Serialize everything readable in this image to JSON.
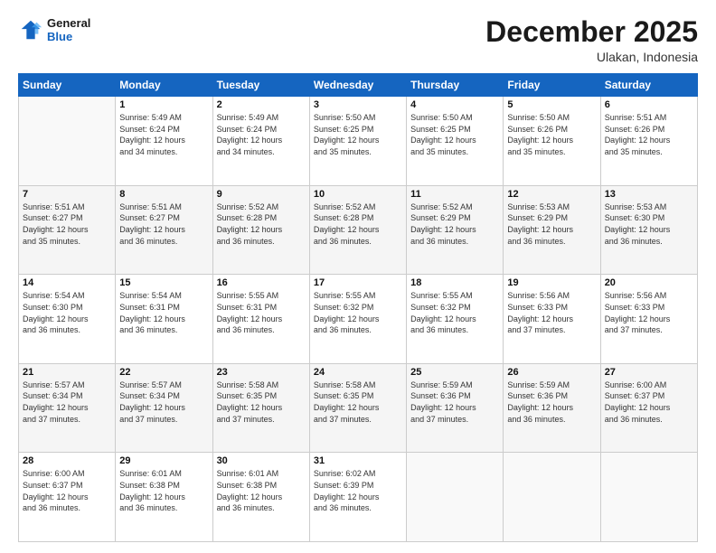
{
  "header": {
    "logo_line1": "General",
    "logo_line2": "Blue",
    "month": "December 2025",
    "location": "Ulakan, Indonesia"
  },
  "days_of_week": [
    "Sunday",
    "Monday",
    "Tuesday",
    "Wednesday",
    "Thursday",
    "Friday",
    "Saturday"
  ],
  "weeks": [
    [
      {
        "num": "",
        "info": ""
      },
      {
        "num": "1",
        "info": "Sunrise: 5:49 AM\nSunset: 6:24 PM\nDaylight: 12 hours\nand 34 minutes."
      },
      {
        "num": "2",
        "info": "Sunrise: 5:49 AM\nSunset: 6:24 PM\nDaylight: 12 hours\nand 34 minutes."
      },
      {
        "num": "3",
        "info": "Sunrise: 5:50 AM\nSunset: 6:25 PM\nDaylight: 12 hours\nand 35 minutes."
      },
      {
        "num": "4",
        "info": "Sunrise: 5:50 AM\nSunset: 6:25 PM\nDaylight: 12 hours\nand 35 minutes."
      },
      {
        "num": "5",
        "info": "Sunrise: 5:50 AM\nSunset: 6:26 PM\nDaylight: 12 hours\nand 35 minutes."
      },
      {
        "num": "6",
        "info": "Sunrise: 5:51 AM\nSunset: 6:26 PM\nDaylight: 12 hours\nand 35 minutes."
      }
    ],
    [
      {
        "num": "7",
        "info": "Sunrise: 5:51 AM\nSunset: 6:27 PM\nDaylight: 12 hours\nand 35 minutes."
      },
      {
        "num": "8",
        "info": "Sunrise: 5:51 AM\nSunset: 6:27 PM\nDaylight: 12 hours\nand 36 minutes."
      },
      {
        "num": "9",
        "info": "Sunrise: 5:52 AM\nSunset: 6:28 PM\nDaylight: 12 hours\nand 36 minutes."
      },
      {
        "num": "10",
        "info": "Sunrise: 5:52 AM\nSunset: 6:28 PM\nDaylight: 12 hours\nand 36 minutes."
      },
      {
        "num": "11",
        "info": "Sunrise: 5:52 AM\nSunset: 6:29 PM\nDaylight: 12 hours\nand 36 minutes."
      },
      {
        "num": "12",
        "info": "Sunrise: 5:53 AM\nSunset: 6:29 PM\nDaylight: 12 hours\nand 36 minutes."
      },
      {
        "num": "13",
        "info": "Sunrise: 5:53 AM\nSunset: 6:30 PM\nDaylight: 12 hours\nand 36 minutes."
      }
    ],
    [
      {
        "num": "14",
        "info": "Sunrise: 5:54 AM\nSunset: 6:30 PM\nDaylight: 12 hours\nand 36 minutes."
      },
      {
        "num": "15",
        "info": "Sunrise: 5:54 AM\nSunset: 6:31 PM\nDaylight: 12 hours\nand 36 minutes."
      },
      {
        "num": "16",
        "info": "Sunrise: 5:55 AM\nSunset: 6:31 PM\nDaylight: 12 hours\nand 36 minutes."
      },
      {
        "num": "17",
        "info": "Sunrise: 5:55 AM\nSunset: 6:32 PM\nDaylight: 12 hours\nand 36 minutes."
      },
      {
        "num": "18",
        "info": "Sunrise: 5:55 AM\nSunset: 6:32 PM\nDaylight: 12 hours\nand 36 minutes."
      },
      {
        "num": "19",
        "info": "Sunrise: 5:56 AM\nSunset: 6:33 PM\nDaylight: 12 hours\nand 37 minutes."
      },
      {
        "num": "20",
        "info": "Sunrise: 5:56 AM\nSunset: 6:33 PM\nDaylight: 12 hours\nand 37 minutes."
      }
    ],
    [
      {
        "num": "21",
        "info": "Sunrise: 5:57 AM\nSunset: 6:34 PM\nDaylight: 12 hours\nand 37 minutes."
      },
      {
        "num": "22",
        "info": "Sunrise: 5:57 AM\nSunset: 6:34 PM\nDaylight: 12 hours\nand 37 minutes."
      },
      {
        "num": "23",
        "info": "Sunrise: 5:58 AM\nSunset: 6:35 PM\nDaylight: 12 hours\nand 37 minutes."
      },
      {
        "num": "24",
        "info": "Sunrise: 5:58 AM\nSunset: 6:35 PM\nDaylight: 12 hours\nand 37 minutes."
      },
      {
        "num": "25",
        "info": "Sunrise: 5:59 AM\nSunset: 6:36 PM\nDaylight: 12 hours\nand 37 minutes."
      },
      {
        "num": "26",
        "info": "Sunrise: 5:59 AM\nSunset: 6:36 PM\nDaylight: 12 hours\nand 36 minutes."
      },
      {
        "num": "27",
        "info": "Sunrise: 6:00 AM\nSunset: 6:37 PM\nDaylight: 12 hours\nand 36 minutes."
      }
    ],
    [
      {
        "num": "28",
        "info": "Sunrise: 6:00 AM\nSunset: 6:37 PM\nDaylight: 12 hours\nand 36 minutes."
      },
      {
        "num": "29",
        "info": "Sunrise: 6:01 AM\nSunset: 6:38 PM\nDaylight: 12 hours\nand 36 minutes."
      },
      {
        "num": "30",
        "info": "Sunrise: 6:01 AM\nSunset: 6:38 PM\nDaylight: 12 hours\nand 36 minutes."
      },
      {
        "num": "31",
        "info": "Sunrise: 6:02 AM\nSunset: 6:39 PM\nDaylight: 12 hours\nand 36 minutes."
      },
      {
        "num": "",
        "info": ""
      },
      {
        "num": "",
        "info": ""
      },
      {
        "num": "",
        "info": ""
      }
    ]
  ]
}
